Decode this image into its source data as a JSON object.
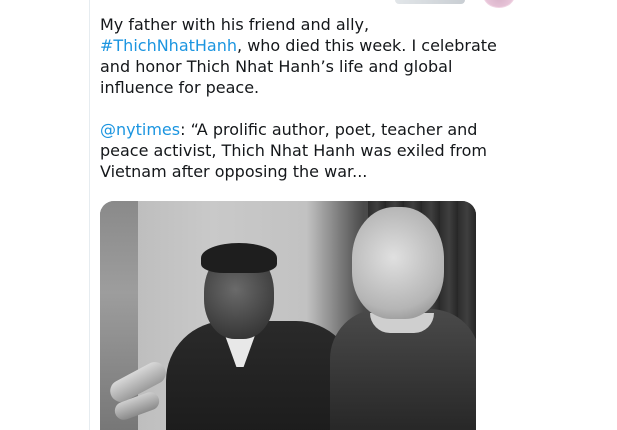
{
  "tweet": {
    "text_line1_before": "My father with his friend and ally,",
    "hashtag": "#ThichNhatHanh",
    "text_after_hashtag": ", who died this week. I celebrate and honor Thich Nhat Hanh’s life and global influence for peace.",
    "mention": "@nytimes",
    "quote_text": ": “A prolific author, poet, teacher and peace activist, Thich Nhat Hanh was exiled from Vietnam after opposing the war..."
  },
  "colors": {
    "link": "#1b95e0",
    "text": "#14171a",
    "border": "#e6ecf0"
  }
}
